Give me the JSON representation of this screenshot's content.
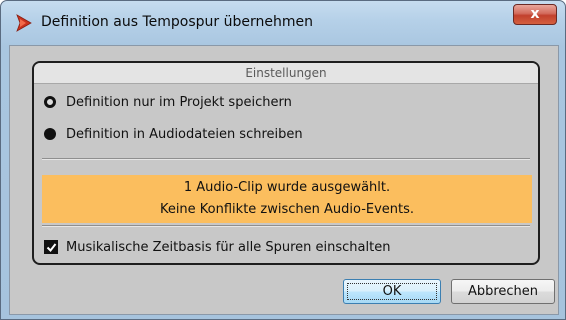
{
  "window": {
    "title": "Definition aus Tempospur übernehmen",
    "close_label": "x",
    "app_icon": "cubase-arrow-icon",
    "accent_color": "#c2402d"
  },
  "panel": {
    "heading": "Einstellungen",
    "options": [
      {
        "label": "Definition nur im Projekt speichern",
        "selected": false
      },
      {
        "label": "Definition in Audiodateien schreiben",
        "selected": true
      }
    ],
    "info": {
      "line1": "1 Audio-Clip wurde ausgewählt.",
      "line2": "Keine Konflikte zwischen Audio-Events.",
      "background": "#fbbe5e"
    },
    "checkbox": {
      "label": "Musikalische Zeitbasis für alle Spuren einschalten",
      "checked": true
    }
  },
  "buttons": {
    "ok_label": "OK",
    "cancel_label": "Abbrechen"
  }
}
